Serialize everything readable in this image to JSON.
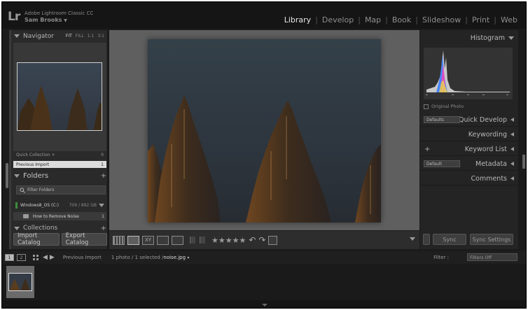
{
  "app": {
    "logo": "Lr",
    "title": "Adobe Lightroom Classic CC",
    "user": "Sam Brooks",
    "user_dropdown": "▼"
  },
  "modules": [
    {
      "label": "Library",
      "active": true
    },
    {
      "label": "Develop",
      "active": false
    },
    {
      "label": "Map",
      "active": false
    },
    {
      "label": "Book",
      "active": false
    },
    {
      "label": "Slideshow",
      "active": false
    },
    {
      "label": "Print",
      "active": false
    },
    {
      "label": "Web",
      "active": false
    }
  ],
  "left_panel": {
    "navigator": {
      "title": "Navigator",
      "zoom": [
        "FIT",
        "FILL",
        "1:1",
        "3:1"
      ]
    },
    "catalog": [
      {
        "label": "Quick Collection +",
        "count": "0"
      },
      {
        "label": "Previous Import",
        "count": "1"
      }
    ],
    "folders": {
      "title": "Folders",
      "add": "+",
      "filter_placeholder": "Filter Folders",
      "drive": {
        "name": "Windows8_OS (C:)",
        "size": "709 / 892 GB"
      },
      "items": [
        {
          "label": "How to Remove Noise",
          "count": "1"
        }
      ]
    },
    "collections": {
      "title": "Collections",
      "add": "+"
    },
    "buttons": {
      "import": "Import Catalog",
      "export": "Export Catalog"
    }
  },
  "toolbar": {
    "stars": "★★★★★",
    "rotate_left": "↶",
    "rotate_right": "↷"
  },
  "right_panel": {
    "histogram": {
      "title": "Histogram",
      "original_photo": "Original Photo"
    },
    "quick_develop": {
      "title": "Quick Develop",
      "preset": "Defaults"
    },
    "keywording": {
      "title": "Keywording"
    },
    "keyword_list": {
      "title": "Keyword List",
      "add": "+"
    },
    "metadata": {
      "title": "Metadata",
      "preset": "Default"
    },
    "comments": {
      "title": "Comments"
    },
    "buttons": {
      "sync": "Sync",
      "sync_settings": "Sync Settings"
    }
  },
  "filmstrip": {
    "pages": [
      "1",
      "2"
    ],
    "source": "Previous Import",
    "info_prefix": "1 photo / 1 selected /",
    "filename": "noise.jpg",
    "filter_label": "Filter :",
    "filter_value": "Filters Off"
  },
  "colors": {
    "accent": "#e8e8e8",
    "panel": "#2a2a2a",
    "background": "#5f5f5f"
  }
}
